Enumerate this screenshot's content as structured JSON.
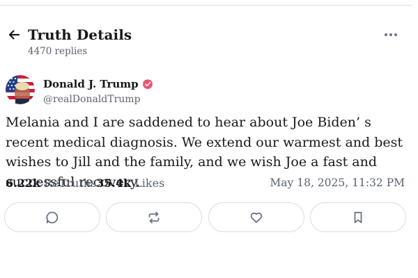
{
  "header": {
    "title": "Truth Details",
    "replies": "4470 replies",
    "back_icon": "arrow-left-icon",
    "more_icon": "more-horizontal-icon"
  },
  "post": {
    "author_name": "Donald J. Trump",
    "author_handle": "@realDonaldTrump",
    "verified_icon": "verified-badge-icon",
    "verified_color": "#f0506e",
    "body": "Melania and I are saddened to hear about Joe Biden’ s recent medical diagnosis. We extend our warmest and best wishes to Jill and the family, and we wish Joe a fast and successful recovery.",
    "retruths_count": "6.22k",
    "retruths_label": "ReTruths",
    "likes_count": "35.4k",
    "likes_label": "Likes",
    "timestamp": "May 18, 2025, 11:32 PM"
  },
  "actions": {
    "reply_icon": "reply-bubble-icon",
    "retruth_icon": "retruth-icon",
    "like_icon": "heart-icon",
    "bookmark_icon": "bookmark-icon"
  },
  "colors": {
    "text": "#16181c",
    "muted": "#5b6270",
    "border": "#d9dbe1",
    "icon": "#6b7280"
  }
}
